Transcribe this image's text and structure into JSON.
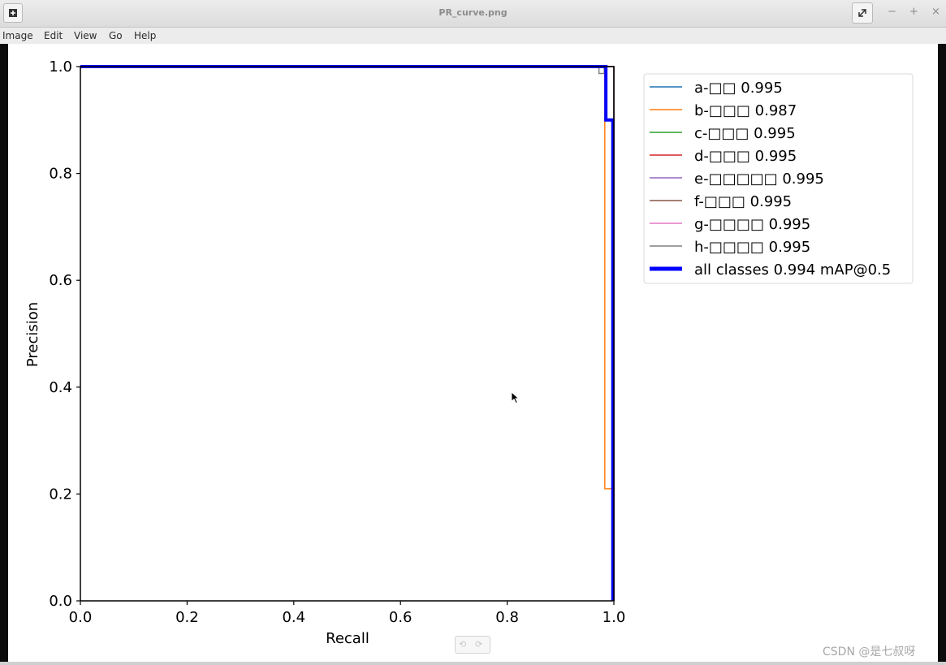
{
  "window": {
    "title": "PR_curve.png"
  },
  "menu": {
    "items": [
      "Image",
      "Edit",
      "View",
      "Go",
      "Help"
    ]
  },
  "watermark": "CSDN @是七叔呀",
  "chart_data": {
    "type": "line",
    "xlabel": "Recall",
    "ylabel": "Precision",
    "xlim": [
      0,
      1
    ],
    "ylim": [
      0,
      1
    ],
    "xticks": [
      "0.0",
      "0.2",
      "0.4",
      "0.6",
      "0.8",
      "1.0"
    ],
    "yticks": [
      "0.0",
      "0.2",
      "0.4",
      "0.6",
      "0.8",
      "1.0"
    ],
    "grid": false,
    "legend_position": "outside-right",
    "series": [
      {
        "name": "a-□□ 0.995",
        "color": "#1f77b4",
        "width": 1.5,
        "x": [
          0,
          0.985,
          1.0,
          1.0
        ],
        "y": [
          1.0,
          1.0,
          1.0,
          0.0
        ]
      },
      {
        "name": "b-□□□ 0.987",
        "color": "#ff7f0e",
        "width": 1.5,
        "x": [
          0,
          0.983,
          0.983,
          0.987,
          0.987,
          1.0,
          1.0
        ],
        "y": [
          1.0,
          1.0,
          0.21,
          0.21,
          0.21,
          0.21,
          0.0
        ]
      },
      {
        "name": "c-□□□ 0.995",
        "color": "#2ca02c",
        "width": 1.5,
        "x": [
          0,
          0.985,
          1.0,
          1.0
        ],
        "y": [
          1.0,
          1.0,
          1.0,
          0.0
        ]
      },
      {
        "name": "d-□□□ 0.995",
        "color": "#d62728",
        "width": 1.5,
        "x": [
          0,
          0.985,
          1.0,
          1.0
        ],
        "y": [
          1.0,
          1.0,
          1.0,
          0.0
        ]
      },
      {
        "name": "e-□□□□□ 0.995",
        "color": "#9467bd",
        "width": 1.5,
        "x": [
          0,
          0.985,
          1.0,
          1.0
        ],
        "y": [
          1.0,
          1.0,
          1.0,
          0.0
        ]
      },
      {
        "name": "f-□□□ 0.995",
        "color": "#8c564b",
        "width": 1.5,
        "x": [
          0,
          0.985,
          1.0,
          1.0
        ],
        "y": [
          1.0,
          1.0,
          1.0,
          0.0
        ]
      },
      {
        "name": "g-□□□□ 0.995",
        "color": "#e377c2",
        "width": 1.5,
        "x": [
          0,
          0.985,
          1.0,
          1.0
        ],
        "y": [
          1.0,
          1.0,
          1.0,
          0.0
        ]
      },
      {
        "name": "h-□□□□ 0.995",
        "color": "#7f7f7f",
        "width": 1.5,
        "x": [
          0,
          0.972,
          0.972,
          0.982,
          0.982,
          1.0,
          1.0
        ],
        "y": [
          1.0,
          1.0,
          0.987,
          0.987,
          1.0,
          1.0,
          0.0
        ]
      },
      {
        "name": "all classes 0.994 mAP@0.5",
        "color": "#0000ff",
        "width": 4,
        "x": [
          0,
          0.983,
          0.985,
          0.985,
          0.998,
          0.998
        ],
        "y": [
          1.0,
          1.0,
          1.0,
          0.9,
          0.9,
          0.0
        ]
      }
    ]
  }
}
